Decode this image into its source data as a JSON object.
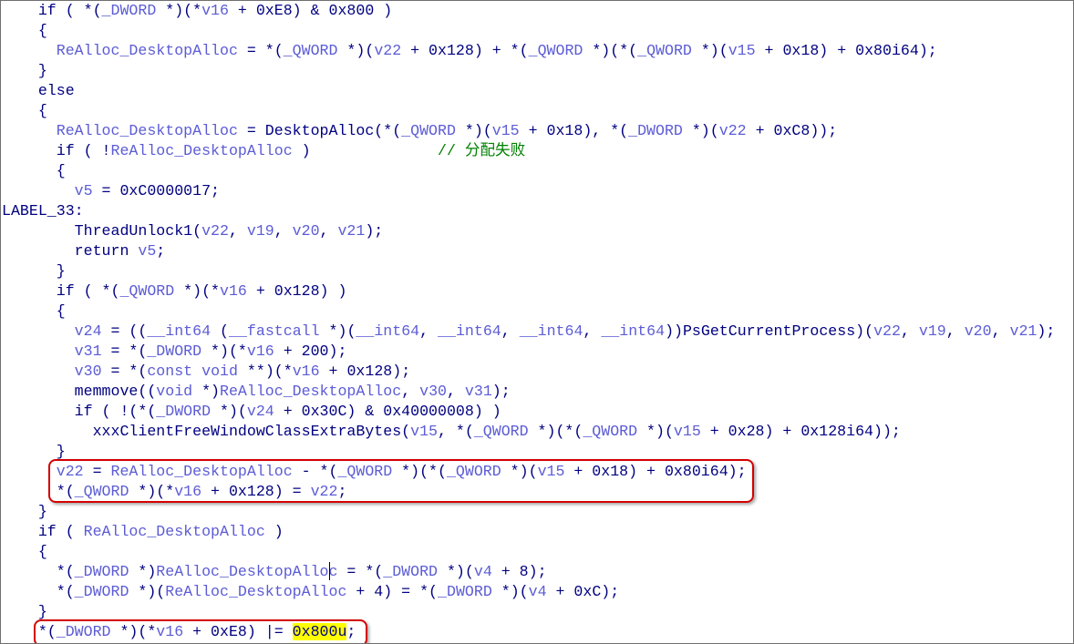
{
  "code_lines": [
    "    if ( *(_DWORD *)(*v16 + 0xE8) & 0x800 )",
    "    {",
    "      ReAlloc_DesktopAlloc = *(_QWORD *)(v22 + 0x128) + *(_QWORD *)(*(_QWORD *)(v15 + 0x18) + 0x80i64);",
    "    }",
    "    else",
    "    {",
    "      ReAlloc_DesktopAlloc = DesktopAlloc(*(_QWORD *)(v15 + 0x18), *(_DWORD *)(v22 + 0xC8));",
    "      if ( !ReAlloc_DesktopAlloc )              // 分配失败",
    "      {",
    "        v5 = 0xC0000017;",
    "LABEL_33:",
    "        ThreadUnlock1(v22, v19, v20, v21);",
    "        return v5;",
    "      }",
    "      if ( *(_QWORD *)(*v16 + 0x128) )",
    "      {",
    "        v24 = ((__int64 (__fastcall *)(__int64, __int64, __int64, __int64))PsGetCurrentProcess)(v22, v19, v20, v21);",
    "        v31 = *(_DWORD *)(*v16 + 200);",
    "        v30 = *(const void **)(*v16 + 0x128);",
    "        memmove((void *)ReAlloc_DesktopAlloc, v30, v31);",
    "        if ( !(*(_DWORD *)(v24 + 0x30C) & 0x40000008) )",
    "          xxxClientFreeWindowClassExtraBytes(v15, *(_QWORD *)(*(_QWORD *)(v15 + 0x28) + 0x128i64));",
    "      }",
    "      v22 = ReAlloc_DesktopAlloc - *(_QWORD *)(*(_QWORD *)(v15 + 0x18) + 0x80i64);",
    "      *(_QWORD *)(*v16 + 0x128) = v22;",
    "    }",
    "    if ( ReAlloc_DesktopAlloc )",
    "    {",
    "      *(_DWORD *)ReAlloc_DesktopAlloc = *(_DWORD *)(v4 + 8);",
    "      *(_DWORD *)(ReAlloc_DesktopAlloc + 4) = *(_DWORD *)(v4 + 0xC);",
    "    }",
    "    *(_DWORD *)(*v16 + 0xE8) |= 0x800u;"
  ],
  "highlight_token": "0x800u",
  "colors": {
    "code": "#000080",
    "variable": "#5c5cd6",
    "comment": "#008000",
    "highlight": "#ffff00",
    "annotation_box": "#d40000"
  }
}
